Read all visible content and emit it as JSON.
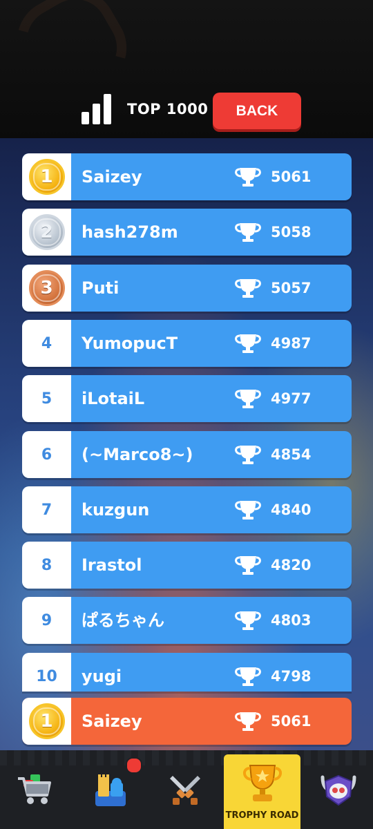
{
  "header": {
    "title": "TOP 1000",
    "back_label": "BACK"
  },
  "leaderboard": [
    {
      "rank": "1",
      "medal": "gold",
      "name": "Saizey",
      "trophies": "5061"
    },
    {
      "rank": "2",
      "medal": "silver",
      "name": "hash278m",
      "trophies": "5058"
    },
    {
      "rank": "3",
      "medal": "bronze",
      "name": "Puti",
      "trophies": "5057"
    },
    {
      "rank": "4",
      "medal": "",
      "name": "YumopucT",
      "trophies": "4987"
    },
    {
      "rank": "5",
      "medal": "",
      "name": "iLotaiL",
      "trophies": "4977"
    },
    {
      "rank": "6",
      "medal": "",
      "name": "(~Marco8~)",
      "trophies": "4854"
    },
    {
      "rank": "7",
      "medal": "",
      "name": "kuzgun",
      "trophies": "4840"
    },
    {
      "rank": "8",
      "medal": "",
      "name": "Irastol",
      "trophies": "4820"
    },
    {
      "rank": "9",
      "medal": "",
      "name": "ぱるちゃん",
      "trophies": "4803"
    },
    {
      "rank": "10",
      "medal": "",
      "name": "yugi",
      "trophies": "4798"
    }
  ],
  "current_player": {
    "rank": "1",
    "medal": "gold",
    "name": "Saizey",
    "trophies": "5061"
  },
  "nav": {
    "items": [
      {
        "icon": "shop-cart-icon"
      },
      {
        "icon": "castle-collection-icon"
      },
      {
        "icon": "crossed-swords-icon"
      },
      {
        "icon": "trophy-icon",
        "label": "TROPHY ROAD",
        "active": true
      },
      {
        "icon": "horned-skull-icon"
      }
    ],
    "notification": true
  },
  "colors": {
    "row_blue": "#3f9cf2",
    "row_orange": "#f4663a",
    "back_red": "#ee3b35",
    "active_tab_yellow": "#f8d636"
  }
}
